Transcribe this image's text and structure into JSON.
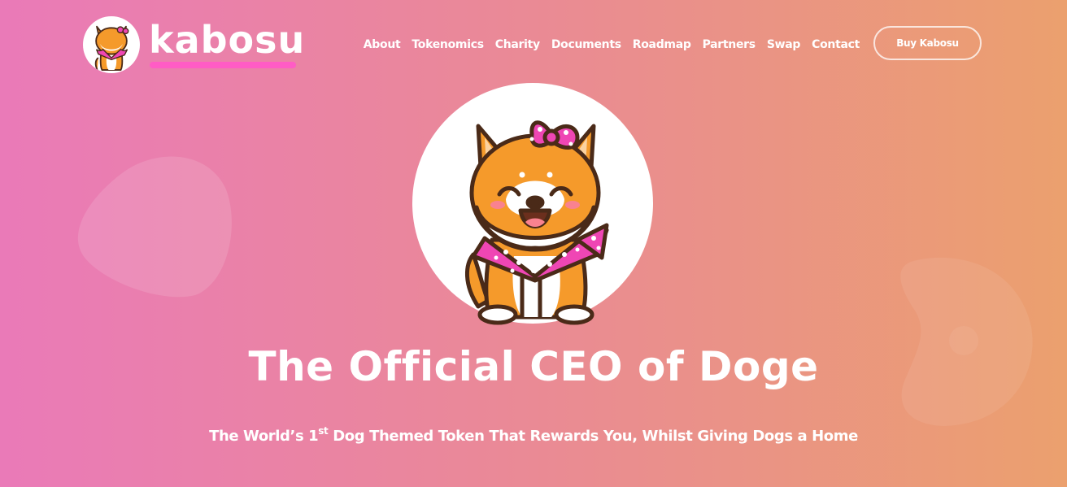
{
  "brand": {
    "name": "kabosu",
    "logo_icon": "shiba-dog-with-pink-bow-icon",
    "accent_color": "#ff5cc5"
  },
  "nav": {
    "items": [
      {
        "label": "About"
      },
      {
        "label": "Tokenomics"
      },
      {
        "label": "Charity"
      },
      {
        "label": "Documents"
      },
      {
        "label": "Roadmap"
      },
      {
        "label": "Partners"
      },
      {
        "label": "Swap"
      },
      {
        "label": "Contact"
      }
    ],
    "cta_label": "Buy Kabosu"
  },
  "hero": {
    "image_icon": "shiba-dog-mascot-icon",
    "title": "The Official CEO of Doge",
    "subtitle_before": "The World’s 1",
    "subtitle_sup": "st",
    "subtitle_after": " Dog Themed Token That Rewards You, Whilst Giving Dogs a Home"
  },
  "colors": {
    "gradient_start": "#ea7ab8",
    "gradient_mid": "#ea8a95",
    "gradient_end": "#eba06e",
    "dog_orange": "#f59a2b",
    "bandana_pink": "#ef46b4"
  }
}
